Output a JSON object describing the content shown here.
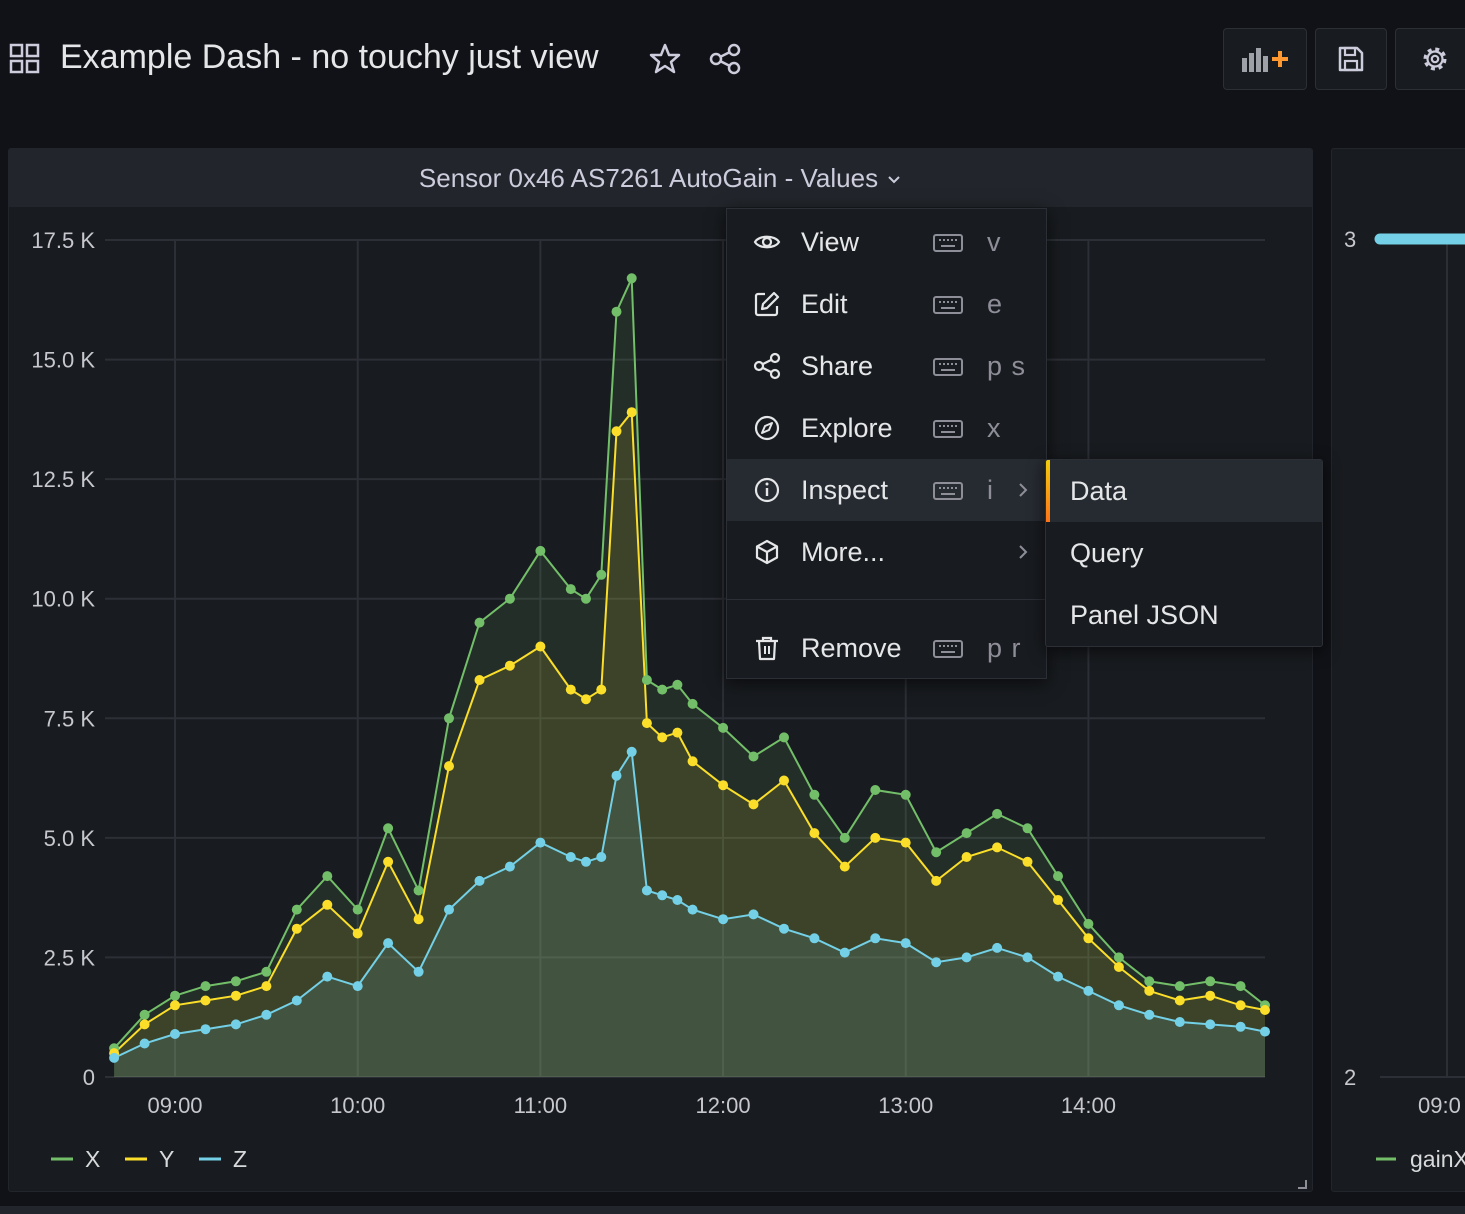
{
  "dashboard": {
    "title": "Example Dash - no touchy just view",
    "icons": [
      "dashboard-grid-icon",
      "star-icon",
      "share-icon"
    ],
    "toolbar": [
      "add-panel-icon",
      "save-icon",
      "settings-gear-icon"
    ]
  },
  "panel": {
    "title": "Sensor 0x46 AS7261 AutoGain - Values",
    "legend": [
      {
        "label": "X",
        "color": "#73bf69"
      },
      {
        "label": "Y",
        "color": "#fade2a"
      },
      {
        "label": "Z",
        "color": "#73d0e6"
      }
    ]
  },
  "panel2": {
    "y_ticks": [
      "3",
      "2"
    ],
    "x_tick": "09:0",
    "legend_label": "gainX",
    "legend_color": "#73bf69",
    "series_color": "#73d0e6"
  },
  "menu": {
    "items": [
      {
        "label": "View",
        "shortcut": "v",
        "icon": "eye-icon"
      },
      {
        "label": "Edit",
        "shortcut": "e",
        "icon": "edit-icon"
      },
      {
        "label": "Share",
        "shortcut": "p s",
        "icon": "share-icon"
      },
      {
        "label": "Explore",
        "shortcut": "x",
        "icon": "compass-icon"
      },
      {
        "label": "Inspect",
        "shortcut": "i",
        "icon": "info-circle-icon"
      },
      {
        "label": "More...",
        "shortcut": "",
        "icon": "cube-icon"
      },
      {
        "label": "Remove",
        "shortcut": "p r",
        "icon": "trash-icon"
      }
    ],
    "submenu": [
      "Data",
      "Query",
      "Panel JSON"
    ]
  },
  "chart_data": {
    "type": "area",
    "title": "Sensor 0x46 AS7261 AutoGain - Values",
    "xlabel": "",
    "ylabel": "",
    "y_ticks": [
      "0",
      "2.5 K",
      "5.0 K",
      "7.5 K",
      "10.0 K",
      "12.5 K",
      "15.0 K",
      "17.5 K"
    ],
    "x_ticks": [
      "09:00",
      "10:00",
      "11:00",
      "12:00",
      "13:00",
      "14:00"
    ],
    "ylim": [
      0,
      17500
    ],
    "xlim": [
      "08:37",
      "14:58"
    ],
    "grid": true,
    "legend_position": "bottom-left",
    "x": [
      "08:40",
      "08:50",
      "09:00",
      "09:10",
      "09:20",
      "09:30",
      "09:40",
      "09:50",
      "10:00",
      "10:10",
      "10:20",
      "10:30",
      "10:40",
      "10:50",
      "11:00",
      "11:10",
      "11:15",
      "11:20",
      "11:25",
      "11:30",
      "11:35",
      "11:40",
      "11:45",
      "11:50",
      "12:00",
      "12:10",
      "12:20",
      "12:30",
      "12:40",
      "12:50",
      "13:00",
      "13:10",
      "13:20",
      "13:30",
      "13:40",
      "13:50",
      "14:00",
      "14:10",
      "14:20",
      "14:30",
      "14:40",
      "14:50",
      "14:58"
    ],
    "series": [
      {
        "name": "X",
        "color": "#73bf69",
        "values": [
          600,
          1300,
          1700,
          1900,
          2000,
          2200,
          3500,
          4200,
          3500,
          5200,
          3900,
          7500,
          9500,
          10000,
          11000,
          10200,
          10000,
          10500,
          16000,
          16700,
          8300,
          8100,
          8200,
          7800,
          7300,
          6700,
          7100,
          5900,
          5000,
          6000,
          5900,
          4700,
          5100,
          5500,
          5200,
          4200,
          3200,
          2500,
          2000,
          1900,
          2000,
          1900,
          1500
        ]
      },
      {
        "name": "Y",
        "color": "#fade2a",
        "values": [
          500,
          1100,
          1500,
          1600,
          1700,
          1900,
          3100,
          3600,
          3000,
          4500,
          3300,
          6500,
          8300,
          8600,
          9000,
          8100,
          7900,
          8100,
          13500,
          13900,
          7400,
          7100,
          7200,
          6600,
          6100,
          5700,
          6200,
          5100,
          4400,
          5000,
          4900,
          4100,
          4600,
          4800,
          4500,
          3700,
          2900,
          2300,
          1800,
          1600,
          1700,
          1500,
          1400
        ]
      },
      {
        "name": "Z",
        "color": "#73d0e6",
        "values": [
          400,
          700,
          900,
          1000,
          1100,
          1300,
          1600,
          2100,
          1900,
          2800,
          2200,
          3500,
          4100,
          4400,
          4900,
          4600,
          4500,
          4600,
          6300,
          6800,
          3900,
          3800,
          3700,
          3500,
          3300,
          3400,
          3100,
          2900,
          2600,
          2900,
          2800,
          2400,
          2500,
          2700,
          2500,
          2100,
          1800,
          1500,
          1300,
          1150,
          1100,
          1050,
          950
        ]
      }
    ]
  }
}
